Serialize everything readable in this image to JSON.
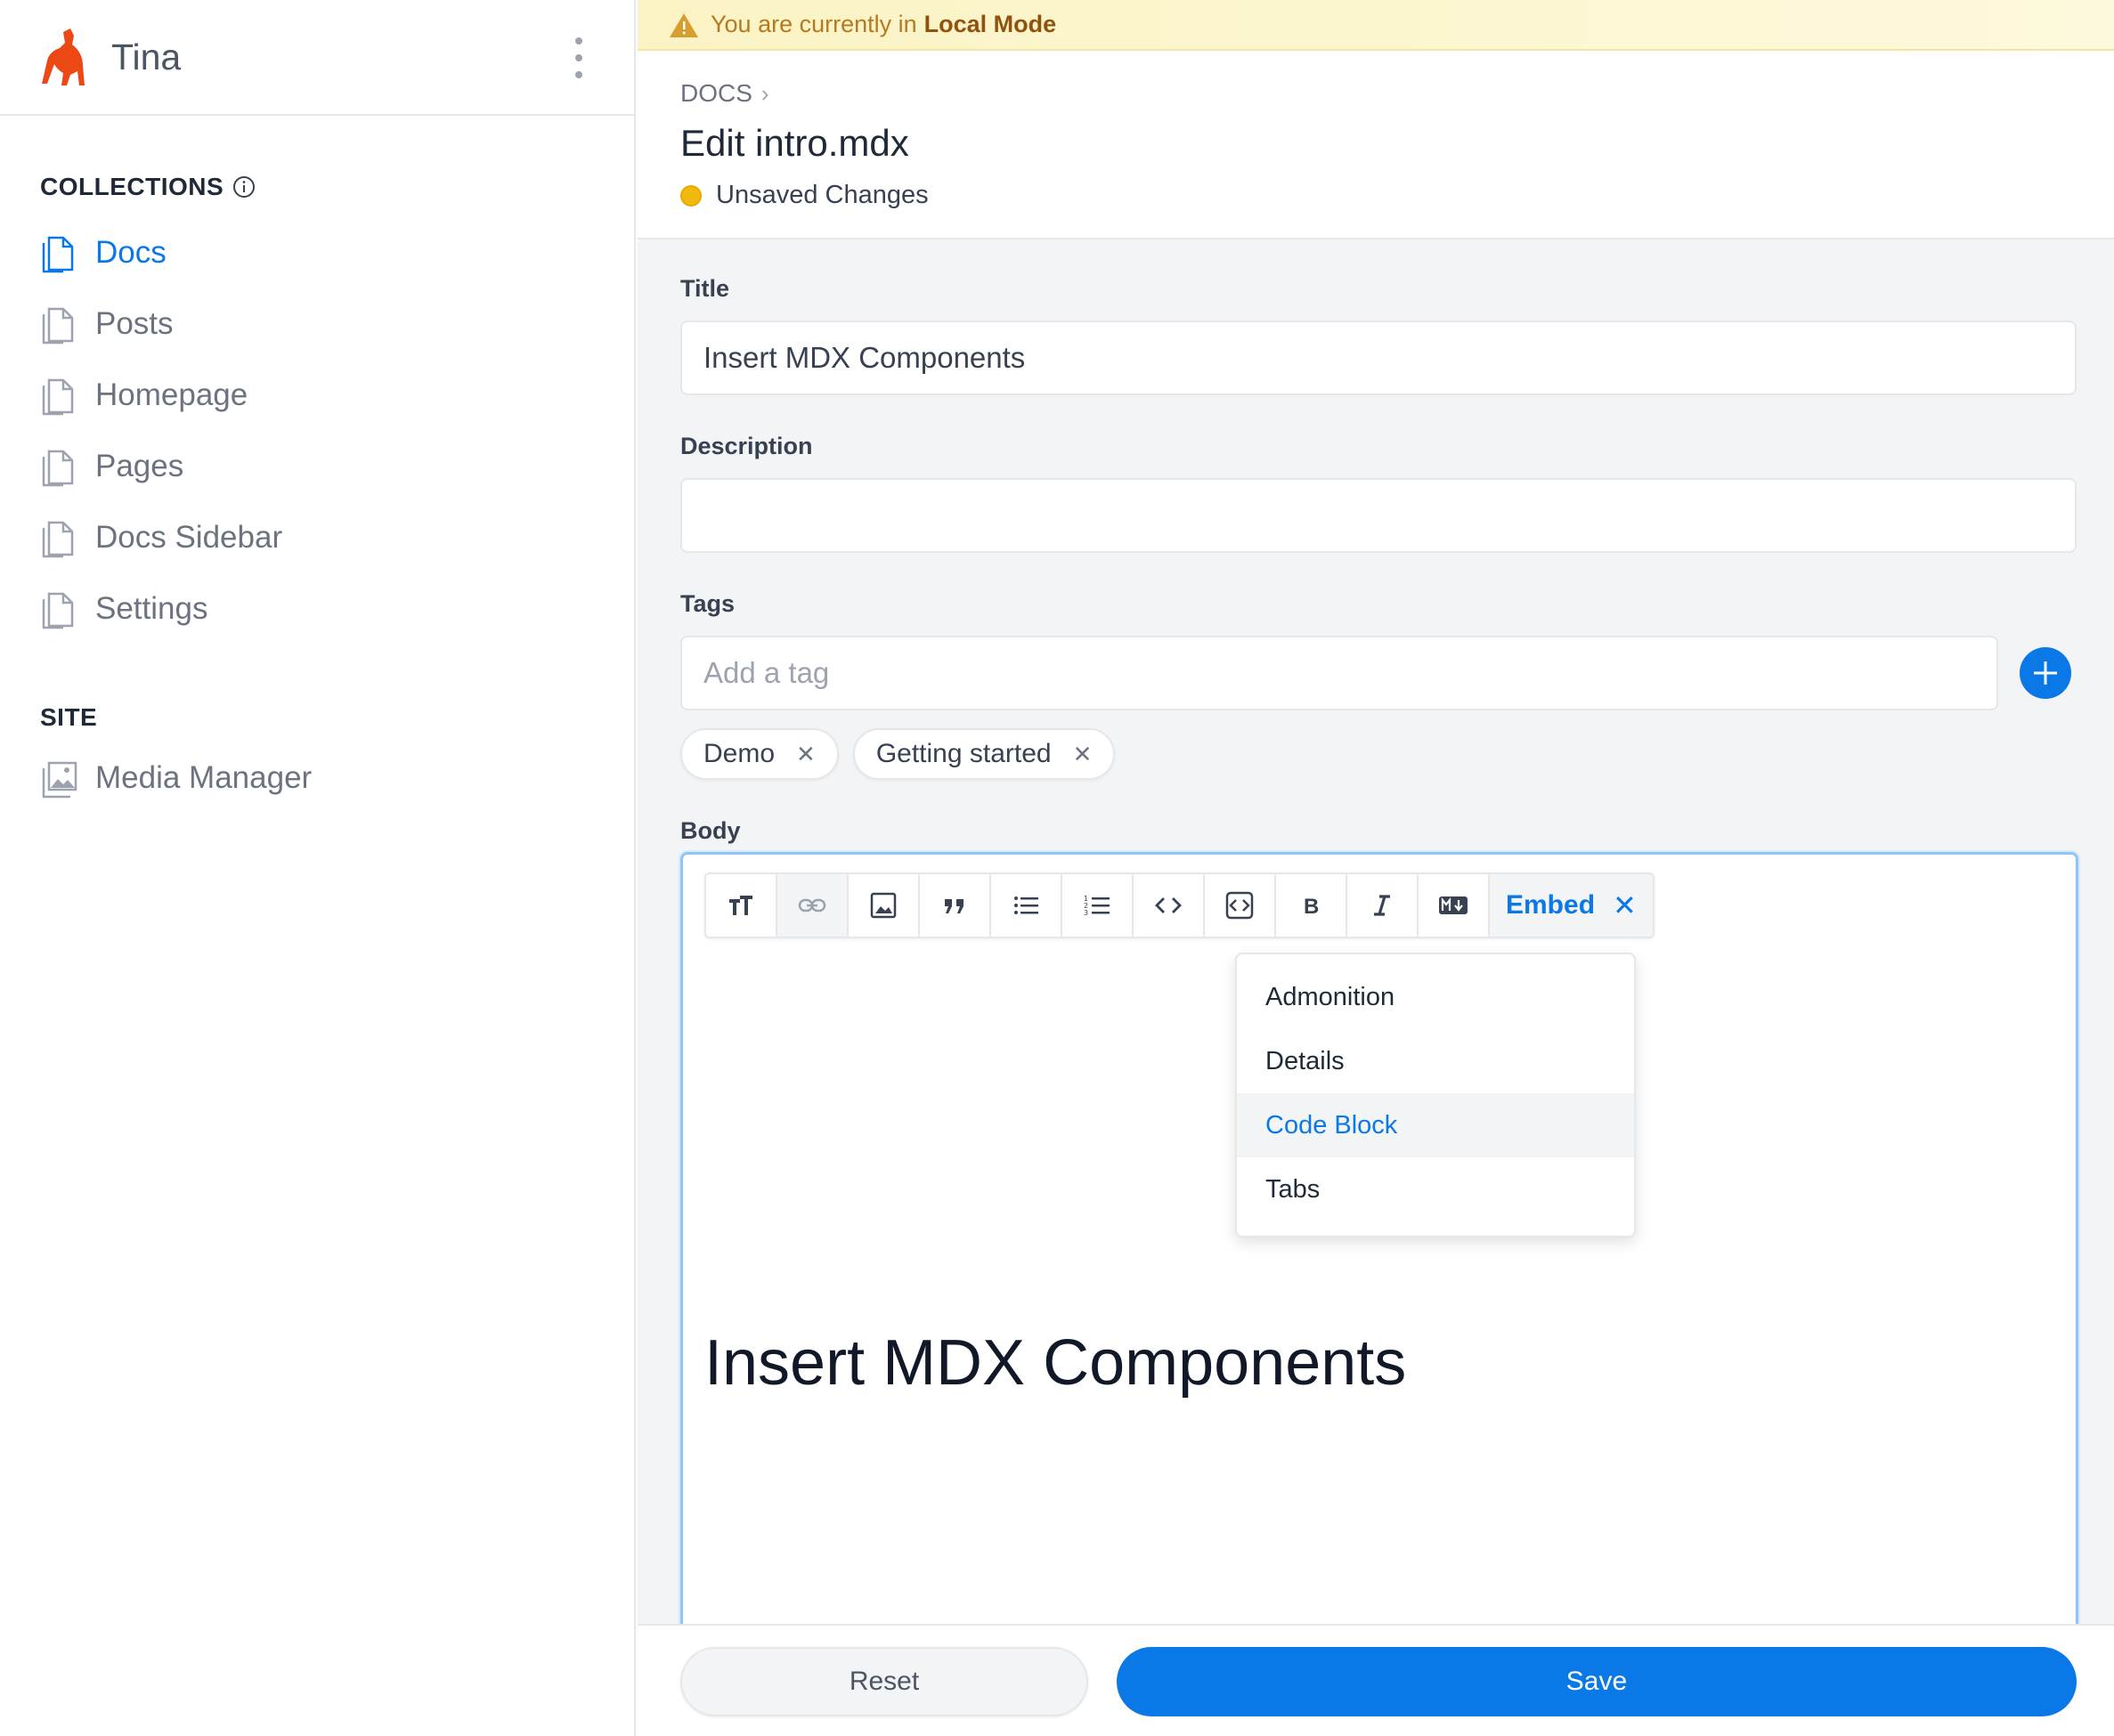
{
  "sidebar": {
    "app_title": "Tina",
    "logo_icon": "llama-logo",
    "collections_title": "COLLECTIONS",
    "collections": [
      {
        "label": "Docs",
        "icon": "document-icon",
        "active": true
      },
      {
        "label": "Posts",
        "icon": "document-icon"
      },
      {
        "label": "Homepage",
        "icon": "document-icon"
      },
      {
        "label": "Pages",
        "icon": "document-icon"
      },
      {
        "label": "Docs Sidebar",
        "icon": "document-icon"
      },
      {
        "label": "Settings",
        "icon": "document-icon"
      }
    ],
    "site_title": "SITE",
    "site_items": [
      {
        "label": "Media Manager",
        "icon": "image-icon"
      }
    ]
  },
  "banner": {
    "text": "You are currently in",
    "mode": "Local Mode",
    "icon": "warning-icon"
  },
  "header": {
    "breadcrumb": "DOCS",
    "title": "Edit intro.mdx",
    "status": "Unsaved Changes"
  },
  "form": {
    "title_label": "Title",
    "title_value": "Insert MDX Components",
    "description_label": "Description",
    "description_value": "",
    "tags_label": "Tags",
    "tags_placeholder": "Add a tag",
    "tags": [
      "Demo",
      "Getting started"
    ],
    "body_label": "Body"
  },
  "editor": {
    "toolbar": [
      "heading-icon",
      "link-icon",
      "image-icon",
      "quote-icon",
      "bullet-list-icon",
      "numbered-list-icon",
      "code-icon",
      "code-block-icon",
      "bold-icon",
      "italic-icon",
      "markdown-icon"
    ],
    "embed_label": "Embed",
    "embed_menu": [
      "Admonition",
      "Details",
      "Code Block",
      "Tabs"
    ],
    "embed_menu_highlighted": "Code Block",
    "heading": "Insert MDX Components"
  },
  "footer": {
    "reset_label": "Reset",
    "save_label": "Save"
  },
  "colors": {
    "accent": "#0b78e8",
    "llama": "#ec4815",
    "unsaved_dot": "#f0b90b",
    "banner_bg": "#fbf3c4"
  }
}
